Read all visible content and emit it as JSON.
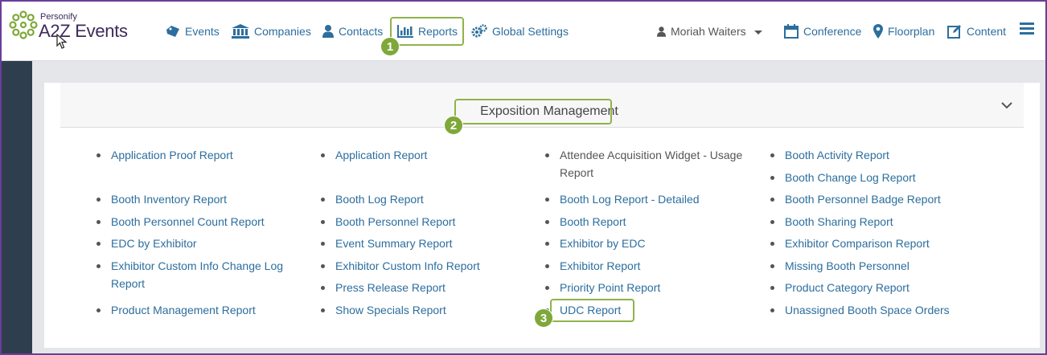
{
  "brand": {
    "small": "Personify",
    "name": "A2Z Events"
  },
  "nav": [
    {
      "label": "Events",
      "icon": "tag-icon"
    },
    {
      "label": "Companies",
      "icon": "bank-icon"
    },
    {
      "label": "Contacts",
      "icon": "user-icon"
    },
    {
      "label": "Reports",
      "icon": "bar-chart-icon"
    },
    {
      "label": "Global Settings",
      "icon": "gears-icon"
    }
  ],
  "user": {
    "name": "Moriah Waiters"
  },
  "right_nav": [
    {
      "label": "Conference",
      "icon": "calendar-icon"
    },
    {
      "label": "Floorplan",
      "icon": "map-marker-icon"
    },
    {
      "label": "Content",
      "icon": "edit-icon"
    }
  ],
  "panel": {
    "title": "Exposition Management"
  },
  "steps": {
    "one": "1",
    "two": "2",
    "three": "3"
  },
  "reports": {
    "col1": [
      [
        "Application Proof Report"
      ],
      [
        "Booth Inventory Report"
      ],
      [
        "Booth Personnel Count Report"
      ],
      [
        "EDC by Exhibitor"
      ],
      [
        "Exhibitor Custom Info Change Log",
        "Report"
      ],
      [
        "Product Management Report"
      ]
    ],
    "col2": [
      [
        "Application Report"
      ],
      [
        "Booth Log Report"
      ],
      [
        "Booth Personnel Report"
      ],
      [
        "Event Summary Report"
      ],
      [
        "Exhibitor Custom Info Report"
      ],
      [
        "Press Release Report"
      ],
      [
        "Show Specials Report"
      ]
    ],
    "col3": [
      [
        "Attendee Acquisition Widget - Usage",
        "Report"
      ],
      [
        "Booth Log Report - Detailed"
      ],
      [
        "Booth Report"
      ],
      [
        "Exhibitor by EDC"
      ],
      [
        "Exhibitor Report"
      ],
      [
        "Priority Point Report"
      ],
      [
        "UDC Report"
      ]
    ],
    "col4": [
      [
        "Booth Activity Report"
      ],
      [
        "Booth Change Log Report"
      ],
      [
        "Booth Personnel Badge Report"
      ],
      [
        "Booth Sharing Report"
      ],
      [
        "Exhibitor Comparison Report"
      ],
      [
        "Missing Booth Personnel"
      ],
      [
        "Product Category Report"
      ],
      [
        "Unassigned Booth Space Orders"
      ]
    ]
  },
  "colors": {
    "link": "#2c6e9e",
    "highlight": "#8fb34a",
    "badge": "#7ea83a",
    "sidebar": "#2f3e4e"
  }
}
